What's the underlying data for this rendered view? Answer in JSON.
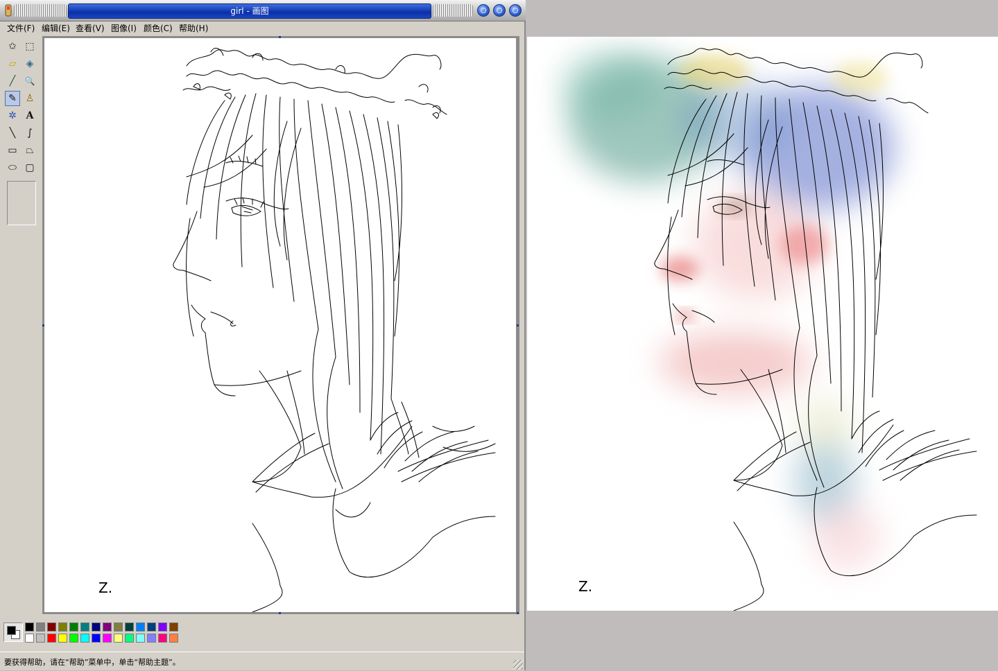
{
  "window": {
    "title": "girl - 画图"
  },
  "menu": {
    "file": "文件(F)",
    "edit": "编辑(E)",
    "view": "查看(V)",
    "image": "图像(I)",
    "colors": "颜色(C)",
    "help": "帮助(H)"
  },
  "tools": [
    {
      "name": "free-select-icon",
      "glyph": "✩"
    },
    {
      "name": "rect-select-icon",
      "glyph": "⬚"
    },
    {
      "name": "eraser-icon",
      "glyph": "▱"
    },
    {
      "name": "fill-icon",
      "glyph": "◈"
    },
    {
      "name": "color-picker-icon",
      "glyph": "╱"
    },
    {
      "name": "magnifier-icon",
      "glyph": "🔍"
    },
    {
      "name": "pencil-icon",
      "glyph": "✎"
    },
    {
      "name": "brush-icon",
      "glyph": "♙"
    },
    {
      "name": "airbrush-icon",
      "glyph": "✲"
    },
    {
      "name": "text-icon",
      "glyph": "A"
    },
    {
      "name": "line-icon",
      "glyph": "╲"
    },
    {
      "name": "curve-icon",
      "glyph": "∫"
    },
    {
      "name": "rectangle-icon",
      "glyph": "▭"
    },
    {
      "name": "polygon-icon",
      "glyph": "⏢"
    },
    {
      "name": "ellipse-icon",
      "glyph": "⬭"
    },
    {
      "name": "rounded-rect-icon",
      "glyph": "▢"
    }
  ],
  "palette": {
    "foreground": "#000000",
    "background": "#ffffff",
    "top_row": [
      "#000000",
      "#808080",
      "#800000",
      "#808000",
      "#008000",
      "#008080",
      "#000080",
      "#800080",
      "#808040",
      "#004040",
      "#0080ff",
      "#004080",
      "#8000ff",
      "#804000"
    ],
    "bottom_row": [
      "#ffffff",
      "#c0c0c0",
      "#ff0000",
      "#ffff00",
      "#00ff00",
      "#00ffff",
      "#0000ff",
      "#ff00ff",
      "#ffff80",
      "#00ff80",
      "#80ffff",
      "#8080ff",
      "#ff0080",
      "#ff8040"
    ]
  },
  "status": {
    "text": "要获得帮助，请在“帮助”菜单中，单击“帮助主题”。"
  },
  "artwork": {
    "signature": "Z."
  }
}
